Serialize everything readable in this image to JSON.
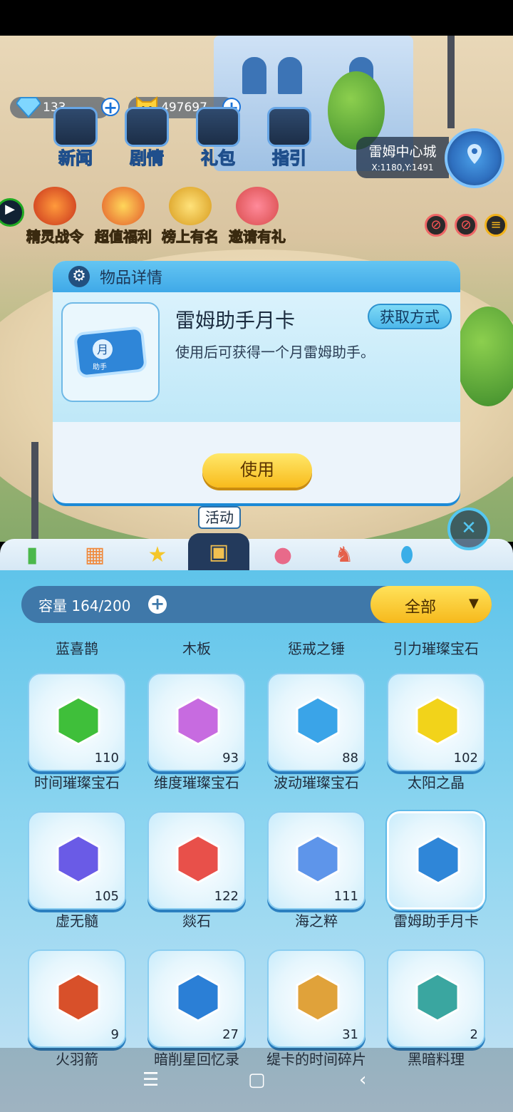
{
  "hud": {
    "diamonds": "133",
    "coins": "497697",
    "buttons": [
      "新闻",
      "剧情",
      "礼包",
      "指引"
    ],
    "events": [
      "精灵战令",
      "超值福利",
      "榜上有名",
      "邀请有礼"
    ],
    "location_name": "雷姆中心城",
    "location_coord": "X:1180,Y:1491"
  },
  "dialog": {
    "title": "物品详情",
    "item_name": "雷姆助手月卡",
    "description": "使用后可获得一个月雷姆助手。",
    "obtain_label": "获取方式",
    "use_label": "使用",
    "card_badge": "月",
    "card_sub": "助手"
  },
  "tabs": {
    "tooltip": "活动",
    "icons": [
      "battery-icon",
      "blocks-icon",
      "star-wand-icon",
      "activity-chest-icon",
      "dress-icon",
      "rocking-horse-icon",
      "egg-icon"
    ],
    "active_index": 3
  },
  "inventory": {
    "capacity_label": "容量 164/200",
    "filter_label": "全部",
    "top_labels": [
      "蓝喜鹊",
      "木板",
      "惩戒之锤",
      "引力璀璨宝石"
    ],
    "rows": [
      [
        {
          "name": "时间璀璨宝石",
          "count": "110",
          "color": "#3fbf3a"
        },
        {
          "name": "维度璀璨宝石",
          "count": "93",
          "color": "#c76be0"
        },
        {
          "name": "波动璀璨宝石",
          "count": "88",
          "color": "#3aa4e8"
        },
        {
          "name": "太阳之晶",
          "count": "102",
          "color": "#f2d31a"
        }
      ],
      [
        {
          "name": "虚无髓",
          "count": "105",
          "color": "#6a5be6"
        },
        {
          "name": "燚石",
          "count": "122",
          "color": "#e8504a"
        },
        {
          "name": "海之粹",
          "count": "111",
          "color": "#5e95ea"
        },
        {
          "name": "雷姆助手月卡",
          "count": "",
          "color": "#2f86d8"
        }
      ],
      [
        {
          "name": "火羽箭",
          "count": "9",
          "color": "#d8502a"
        },
        {
          "name": "暗削星回忆录",
          "count": "27",
          "color": "#2b7fd6"
        },
        {
          "name": "缇卡的时间碎片",
          "count": "31",
          "color": "#e0a23a"
        },
        {
          "name": "黑暗料理",
          "count": "2",
          "color": "#3aa6a0"
        }
      ]
    ]
  },
  "nav": {
    "menu": "☰",
    "home": "▢",
    "back": "‹"
  }
}
